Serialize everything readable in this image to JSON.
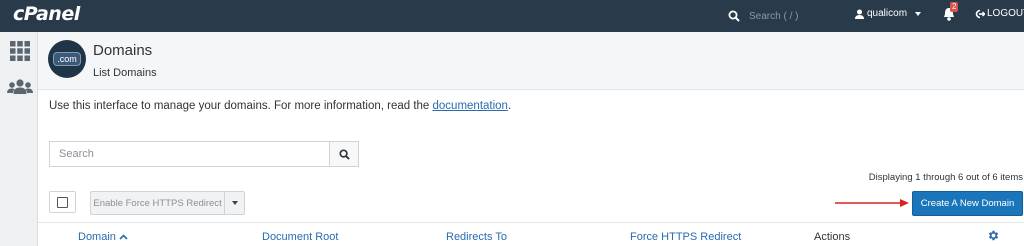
{
  "topbar": {
    "logo": "cPanel",
    "search_placeholder": "Search ( / )",
    "username": "qualicom",
    "notification_count": "2",
    "logout_label": "LOGOUT"
  },
  "page": {
    "title": "Domains",
    "subtitle": "List Domains",
    "badge_text": ".com",
    "intro_text": "Use this interface to manage your domains. For more information, read the ",
    "intro_link": "documentation",
    "intro_end": "."
  },
  "search": {
    "placeholder": "Search"
  },
  "listing": {
    "displaying": "Displaying 1 through 6 out of 6 items",
    "force_https_label": "Enable Force HTTPS Redirect",
    "create_label": "Create A New Domain"
  },
  "table": {
    "columns": [
      "Domain",
      "Document Root",
      "Redirects To",
      "Force HTTPS Redirect",
      "Actions"
    ]
  },
  "colors": {
    "topbar": "#293a4a",
    "primary": "#1b75bb",
    "link": "#2a6bb0",
    "arrow": "#d9231d"
  }
}
